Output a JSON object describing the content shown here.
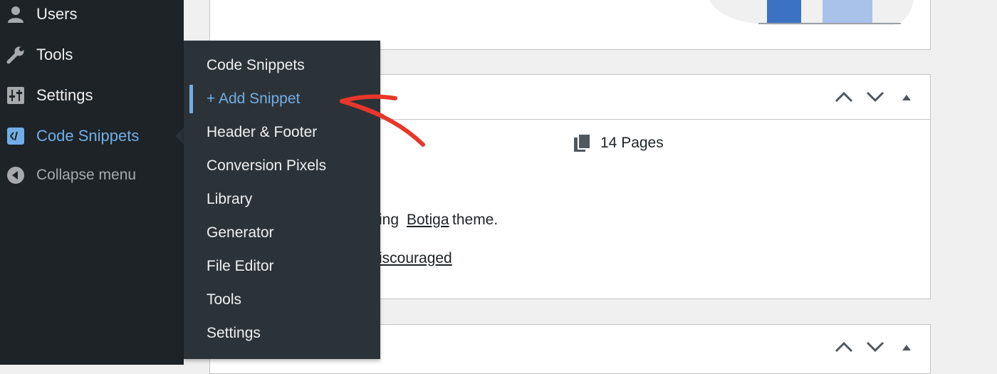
{
  "sidebar": {
    "items": [
      {
        "label": "Users",
        "icon": "users-icon"
      },
      {
        "label": "Tools",
        "icon": "wrench-icon"
      },
      {
        "label": "Settings",
        "icon": "settings-sliders-icon"
      },
      {
        "label": "Code Snippets",
        "icon": "code-snippets-icon",
        "current": true
      },
      {
        "label": "Collapse menu",
        "icon": "collapse-icon"
      }
    ]
  },
  "flyout": {
    "items": [
      {
        "label": "Code Snippets"
      },
      {
        "label": "+ Add Snippet",
        "active": true
      },
      {
        "label": "Header & Footer"
      },
      {
        "label": "Conversion Pixels"
      },
      {
        "label": "Library"
      },
      {
        "label": "Generator"
      },
      {
        "label": "File Editor"
      },
      {
        "label": "Tools"
      },
      {
        "label": "Settings"
      }
    ]
  },
  "at_a_glance": {
    "pages_count": "14 Pages",
    "theme_prefix": "ing ",
    "theme_name": "Botiga",
    "theme_suffix": " theme.",
    "search_engines_link": "iscouraged"
  },
  "colors": {
    "sidebar_bg": "#1d2327",
    "flyout_bg": "#2c3338",
    "accent": "#72aee6",
    "link": "#2271b1",
    "annotation_arrow": "#e8372a"
  }
}
